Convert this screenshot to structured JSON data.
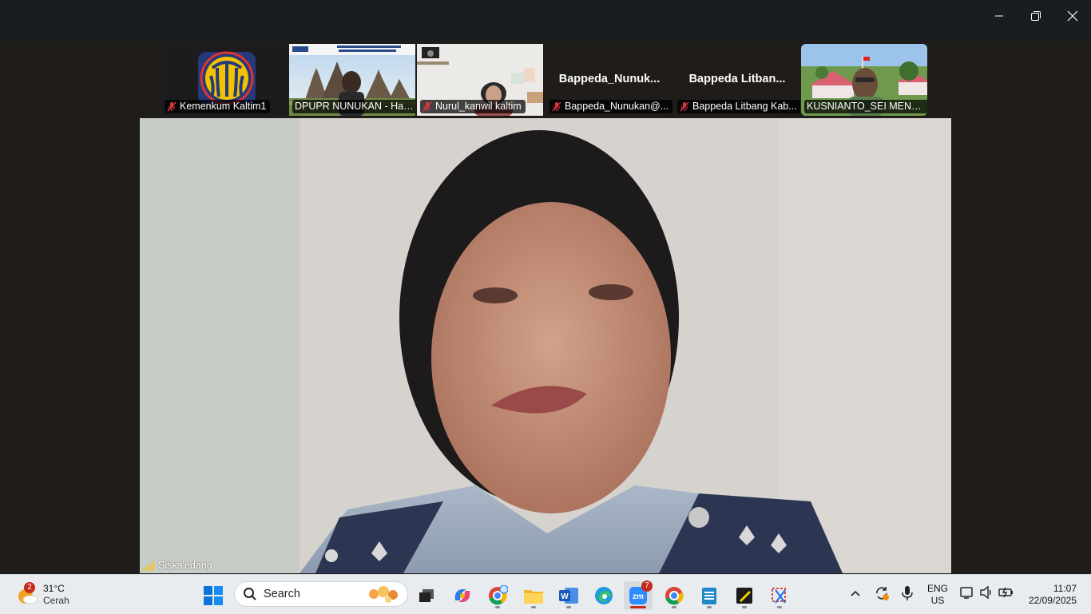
{
  "window": {
    "minimize_label": "",
    "restore_label": "",
    "close_label": ""
  },
  "participants": [
    {
      "name": "Kemenkum Kaltim1",
      "display": "",
      "muted": true,
      "kind": "logo"
    },
    {
      "name": "DPUPR NUNUKAN - Has...",
      "display": "",
      "muted": false,
      "kind": "video-temple"
    },
    {
      "name": "Nurul_kanwil kaltim",
      "display": "",
      "muted": true,
      "kind": "video-room"
    },
    {
      "name": "Bappeda_Nunukan@...",
      "display": "Bappeda_Nunuk...",
      "muted": true,
      "kind": "name"
    },
    {
      "name": "Bappeda Litbang Kab...",
      "display": "Bappeda  Litban...",
      "muted": true,
      "kind": "name"
    },
    {
      "name": "KUSNIANTO_SEI MENG...",
      "display": "",
      "muted": false,
      "kind": "video-outdoor"
    }
  ],
  "speaker": {
    "name": "Siska'edang"
  },
  "taskbar": {
    "weather": {
      "temp": "31°C",
      "desc": "Cerah",
      "badge": "2"
    },
    "search": {
      "label": "Search"
    },
    "zoom_badge": "7",
    "language": {
      "line1": "ENG",
      "line2": "US"
    },
    "clock": {
      "time": "11:07",
      "date": "22/09/2025"
    },
    "icons": [
      "windows-start-icon",
      "task-view-icon",
      "copilot-icon",
      "chrome-profile-icon",
      "file-explorer-icon",
      "word-icon",
      "edge-icon",
      "zoom-icon",
      "chrome-icon",
      "notepad-icon",
      "sticky-notes-icon",
      "snipping-tool-icon"
    ]
  },
  "colors": {
    "accent": "#0067c0",
    "zoom": "#2d8cff",
    "mute": "#e0353f",
    "taskbar": "#e9ecef"
  }
}
